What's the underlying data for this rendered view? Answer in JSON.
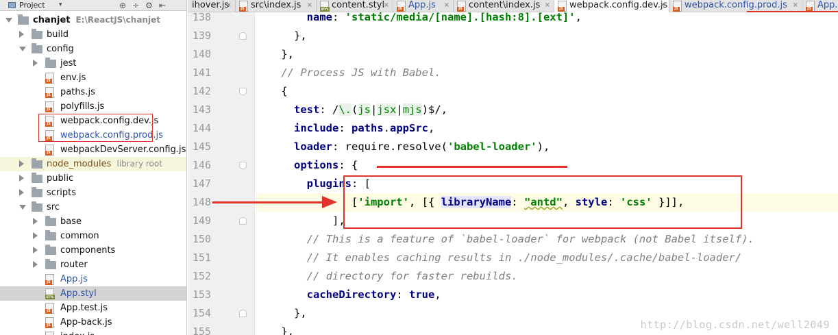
{
  "panel": {
    "title": "Project",
    "dropdown_icon": "chevron-down-icon",
    "tool_icons": [
      "target-icon",
      "split-icon",
      "gear-icon",
      "hide-icon"
    ]
  },
  "tree": [
    {
      "name": "chanjet",
      "hint": "E:\\ReactJS\\chanjet",
      "type": "folder",
      "level": 0,
      "state": "expanded",
      "style": "bold"
    },
    {
      "name": "build",
      "type": "folder",
      "level": 1,
      "state": "collapsed"
    },
    {
      "name": "config",
      "type": "folder",
      "level": 1,
      "state": "expanded"
    },
    {
      "name": "jest",
      "type": "folder",
      "level": 2,
      "state": "collapsed"
    },
    {
      "name": "env.js",
      "type": "js",
      "level": 2
    },
    {
      "name": "paths.js",
      "type": "js",
      "level": 2
    },
    {
      "name": "polyfills.js",
      "type": "js",
      "level": 2
    },
    {
      "name": "webpack.config.dev.js",
      "type": "js",
      "level": 2
    },
    {
      "name": "webpack.config.prod.js",
      "type": "js",
      "level": 2,
      "style": "blue"
    },
    {
      "name": "webpackDevServer.config.js",
      "type": "js",
      "level": 2
    },
    {
      "name": "node_modules",
      "hint": "library root",
      "type": "folder",
      "level": 1,
      "state": "collapsed",
      "style": "brown",
      "row": "highlight"
    },
    {
      "name": "public",
      "type": "folder",
      "level": 1,
      "state": "collapsed"
    },
    {
      "name": "scripts",
      "type": "folder",
      "level": 1,
      "state": "collapsed"
    },
    {
      "name": "src",
      "type": "folder",
      "level": 1,
      "state": "expanded"
    },
    {
      "name": "base",
      "type": "folder",
      "level": 2,
      "state": "collapsed"
    },
    {
      "name": "common",
      "type": "folder",
      "level": 2,
      "state": "collapsed"
    },
    {
      "name": "components",
      "type": "folder",
      "level": 2,
      "state": "collapsed"
    },
    {
      "name": "router",
      "type": "folder",
      "level": 2,
      "state": "collapsed"
    },
    {
      "name": "App.js",
      "type": "js",
      "level": 2,
      "style": "blue"
    },
    {
      "name": "App.styl",
      "type": "styl",
      "level": 2,
      "style": "blue",
      "row": "selected"
    },
    {
      "name": "App.test.js",
      "type": "js",
      "level": 2
    },
    {
      "name": "App-back.js",
      "type": "js",
      "level": 2
    },
    {
      "name": "index.js",
      "type": "js",
      "level": 2
    }
  ],
  "tabs": [
    {
      "label": "ihover.js",
      "icon": "js"
    },
    {
      "label": "src\\index.js",
      "icon": "js"
    },
    {
      "label": "content.styl",
      "icon": "styl"
    },
    {
      "label": "App.js",
      "icon": "js",
      "style": "blue"
    },
    {
      "label": "content\\index.js",
      "icon": "js"
    },
    {
      "label": "webpack.config.dev.js",
      "icon": "js",
      "active": true
    },
    {
      "label": "webpack.config.prod.js",
      "icon": "js",
      "style": "blue"
    },
    {
      "label": "App.s",
      "icon": "js",
      "style": "blue"
    }
  ],
  "tab_close_glyph": "×",
  "editor": {
    "current_line": "148",
    "lines": [
      {
        "no": "138",
        "html": "        <span class=\"k\">name</span>: <span class=\"s\">'static/media/[name].[hash:8].[ext]'</span>,"
      },
      {
        "no": "139",
        "html": "      },"
      },
      {
        "no": "140",
        "html": "    },"
      },
      {
        "no": "141",
        "html": "    <span class=\"c\">// Process JS with Babel.</span>"
      },
      {
        "no": "142",
        "html": "    {"
      },
      {
        "no": "143",
        "html": "      <span class=\"k\">test</span>: /<span class=\"rxh\">\\.</span>(<span class=\"rxh\">js</span>|<span class=\"rxh\">jsx</span>|<span class=\"rxh\">mjs</span>)$/,"
      },
      {
        "no": "144",
        "html": "      <span class=\"k\">include</span>: <span class=\"k\">paths</span>.<span class=\"k\">appSrc</span>,"
      },
      {
        "no": "145",
        "html": "      <span class=\"k\">loader</span>: require.resolve(<span class=\"s\">'babel-loader'</span>),"
      },
      {
        "no": "146",
        "html": "      <span class=\"k\">options</span>: {"
      },
      {
        "no": "147",
        "html": "        <span class=\"k\">plugins</span>: ["
      },
      {
        "no": "148",
        "html": "               [<span class=\"s\">'import'</span>, [{ <span class=\"k prop-hl\">libraryName</span>: <span class=\"s underline-squig\">\"antd\"</span>, <span class=\"k\">style</span>: <span class=\"s\">'css'</span> }]],"
      },
      {
        "no": "149",
        "html": "            ],"
      },
      {
        "no": "150",
        "html": "        <span class=\"c\">// This is a feature of `babel-loader` for webpack (not Babel itself).</span>"
      },
      {
        "no": "151",
        "html": "        <span class=\"c\">// It enables caching results in ./node_modules/.cache/babel-loader/</span>"
      },
      {
        "no": "152",
        "html": "        <span class=\"c\">// directory for faster rebuilds.</span>"
      },
      {
        "no": "153",
        "html": "        <span class=\"k\">cacheDirectory</span>: <span class=\"n\">true</span>,"
      },
      {
        "no": "154",
        "html": "      },"
      },
      {
        "no": "155",
        "html": "    },"
      }
    ],
    "folds": [
      {
        "line": "139",
        "dir": "up"
      },
      {
        "line": "142",
        "dir": "down"
      },
      {
        "line": "146",
        "dir": "down"
      },
      {
        "line": "149",
        "dir": "up"
      },
      {
        "line": "154",
        "dir": "up"
      }
    ]
  },
  "annotations": {
    "color": "#e0342a"
  },
  "watermark": "http://blog.csdn.net/well2049"
}
